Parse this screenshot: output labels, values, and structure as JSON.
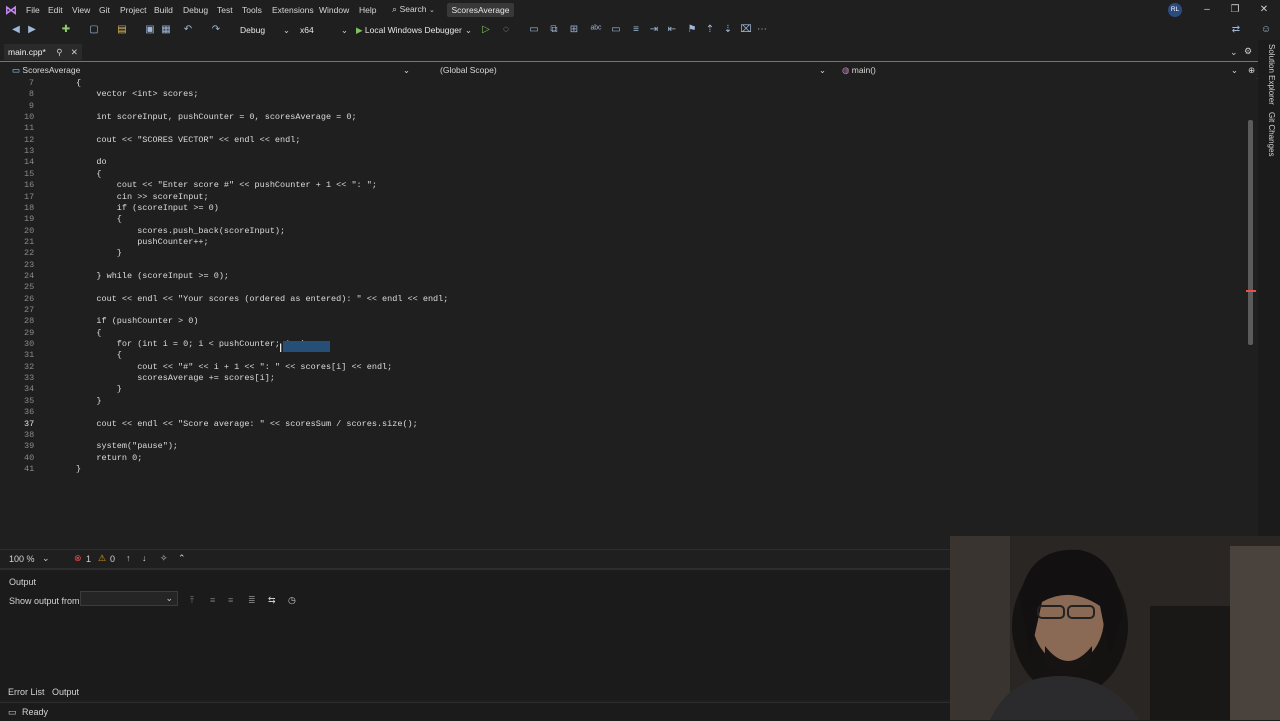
{
  "menubar": {
    "items": [
      "File",
      "Edit",
      "View",
      "Git",
      "Project",
      "Build",
      "Debug",
      "Test",
      "Tools",
      "Extensions",
      "Window",
      "Help"
    ],
    "search_label": "Search",
    "project_name": "ScoresAverage",
    "avatar_initials": "RL"
  },
  "toolbar": {
    "configuration": "Debug",
    "platform": "x64",
    "run_label": "Local Windows Debugger"
  },
  "tabs": [
    {
      "label": "main.cpp*"
    }
  ],
  "navbar": {
    "project": "ScoresAverage",
    "scope": "(Global Scope)",
    "member": "main()"
  },
  "code": {
    "lines": [
      {
        "n": "7",
        "text": "{"
      },
      {
        "n": "8",
        "text": "    vector <int> scores;"
      },
      {
        "n": "9",
        "text": ""
      },
      {
        "n": "10",
        "text": "    int scoreInput, pushCounter = 0, scoresAverage = 0;"
      },
      {
        "n": "11",
        "text": ""
      },
      {
        "n": "12",
        "text": "    cout << \"SCORES VECTOR\" << endl << endl;"
      },
      {
        "n": "13",
        "text": ""
      },
      {
        "n": "14",
        "text": "    do"
      },
      {
        "n": "15",
        "text": "    {"
      },
      {
        "n": "16",
        "text": "        cout << \"Enter score #\" << pushCounter + 1 << \": \";"
      },
      {
        "n": "17",
        "text": "        cin >> scoreInput;"
      },
      {
        "n": "18",
        "text": "        if (scoreInput >= 0)"
      },
      {
        "n": "19",
        "text": "        {"
      },
      {
        "n": "20",
        "text": "            scores.push_back(scoreInput);"
      },
      {
        "n": "21",
        "text": "            pushCounter++;"
      },
      {
        "n": "22",
        "text": "        }"
      },
      {
        "n": "23",
        "text": ""
      },
      {
        "n": "24",
        "text": "    } while (scoreInput >= 0);"
      },
      {
        "n": "25",
        "text": ""
      },
      {
        "n": "26",
        "text": "    cout << endl << \"Your scores (ordered as entered): \" << endl << endl;"
      },
      {
        "n": "27",
        "text": ""
      },
      {
        "n": "28",
        "text": "    if (pushCounter > 0)"
      },
      {
        "n": "29",
        "text": "    {"
      },
      {
        "n": "30",
        "text": "        for (int i = 0; i < pushCounter; i++)"
      },
      {
        "n": "31",
        "text": "        {"
      },
      {
        "n": "32",
        "text": "            cout << \"#\" << i + 1 << \": \" << scores[i] << endl;"
      },
      {
        "n": "33",
        "text": "            scoresAverage += scores[i];"
      },
      {
        "n": "34",
        "text": "        }"
      },
      {
        "n": "35",
        "text": "    }"
      },
      {
        "n": "36",
        "text": ""
      },
      {
        "n": "37",
        "text": "    cout << endl << \"Score average: \" << scoresSum / scores.size();"
      },
      {
        "n": "38",
        "text": ""
      },
      {
        "n": "39",
        "text": "    system(\"pause\");"
      },
      {
        "n": "40",
        "text": "    return 0;"
      },
      {
        "n": "41",
        "text": "}"
      }
    ],
    "selected_token": "scoresSum",
    "current_line": "37"
  },
  "editor_status": {
    "zoom": "100 %",
    "errors": "1",
    "warnings": "0"
  },
  "output": {
    "title": "Output",
    "show_from_label": "Show output from:",
    "show_from_value": ""
  },
  "bottom_tabs": [
    "Error List",
    "Output"
  ],
  "right_rail": [
    "Solution Explorer",
    "Git Changes"
  ],
  "status": {
    "text": "Ready"
  },
  "colors": {
    "accent": "#7160e8",
    "selection": "#264f78",
    "error": "#f14c4c",
    "warning": "#e8a317",
    "keyword": "#569cd6",
    "string": "#d69d85",
    "identifier": "#9cdcfe"
  }
}
